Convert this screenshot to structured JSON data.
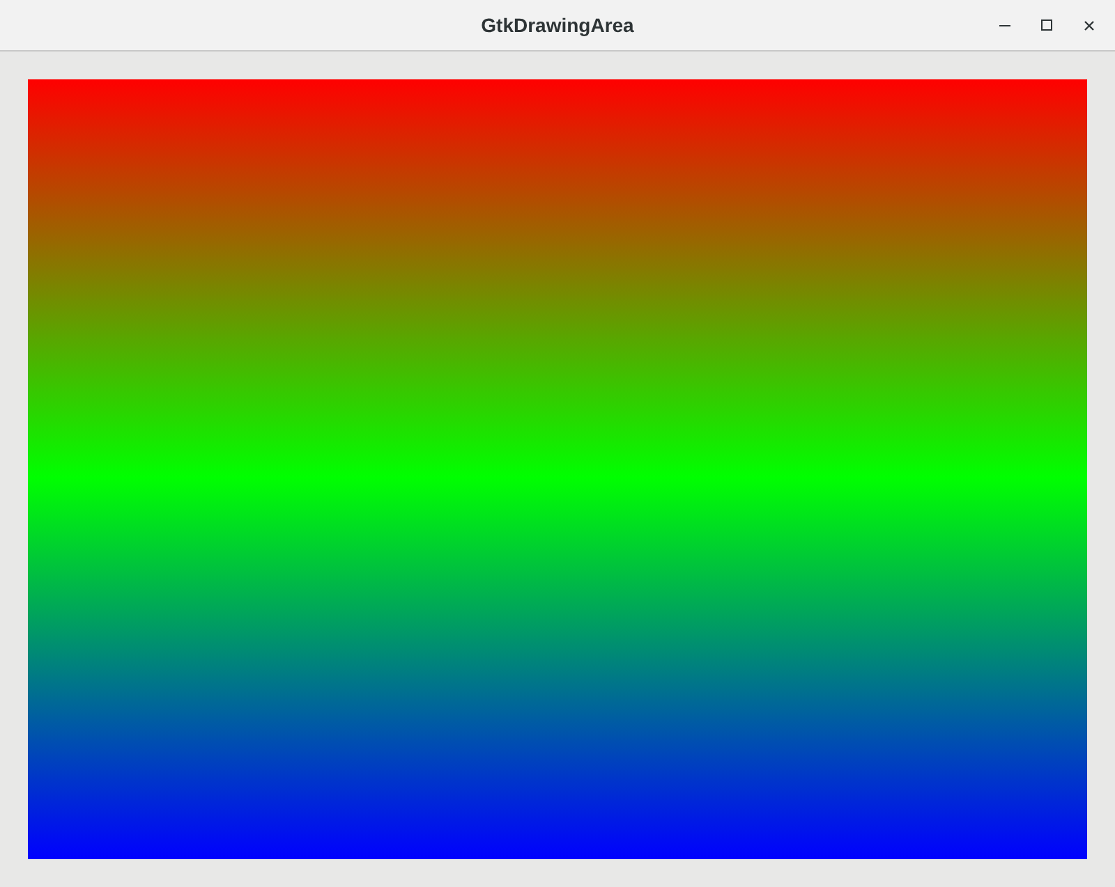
{
  "window": {
    "title": "GtkDrawingArea"
  }
}
